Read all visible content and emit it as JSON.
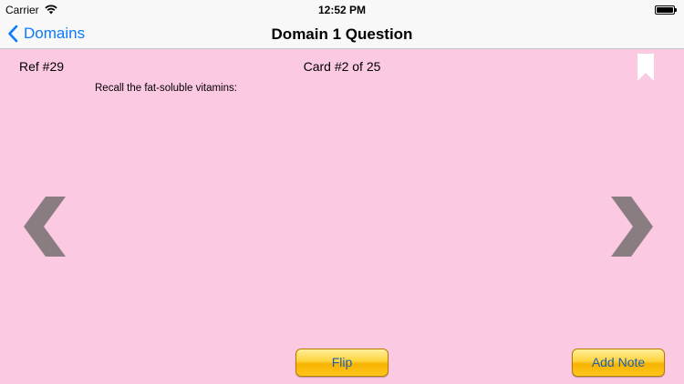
{
  "status_bar": {
    "carrier": "Carrier",
    "time": "12:52 PM"
  },
  "nav_bar": {
    "back_label": "Domains",
    "title": "Domain 1 Question",
    "accent_color": "#0a7aff"
  },
  "card": {
    "ref": "Ref #29",
    "counter": "Card #2 of 25",
    "question": "Recall the fat-soluble vitamins:",
    "background_color": "#fcc9e3"
  },
  "buttons": {
    "flip_label": "Flip",
    "add_note_label": "Add Note"
  },
  "icons": {
    "bookmark": "bookmark-icon",
    "prev": "chevron-left-icon",
    "next": "chevron-right-icon"
  }
}
